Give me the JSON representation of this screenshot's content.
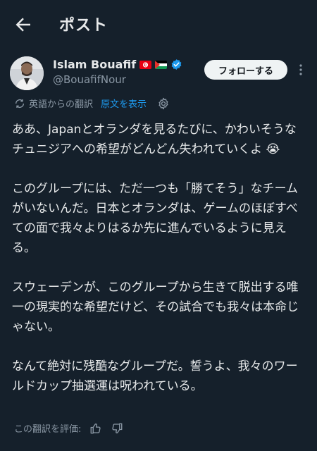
{
  "header": {
    "title": "ポスト",
    "back_icon": "arrow-left-icon"
  },
  "author": {
    "display_name": "Islam Bouafif",
    "handle": "@BouafifNour",
    "badges": [
      "tunisia-flag-icon",
      "palestine-flag-icon",
      "verified-badge-icon"
    ],
    "verified_color": "#1d9bf0"
  },
  "actions": {
    "follow_label": "フォローする",
    "more_icon": "more-vertical-icon"
  },
  "translation": {
    "label": "英語からの翻訳",
    "show_original": "原文を表示",
    "settings_icon": "gear-icon"
  },
  "tweet": {
    "paragraphs": [
      "ああ、Japanとオランダを見るたびに、かわいそうなチュニジアへの希望がどんどん失われていくよ 😭",
      "このグループには、ただ一つも「勝てそう」なチームがいないんだ。日本とオランダは、ゲームのほぼすべての面で我々よりはるか先に進んでいるように見える。",
      "スウェーデンが、このグループから生きて脱出する唯一の現実的な希望だけど、その試合でも我々は本命じゃない。",
      "なんて絶対に残酷なグループだ。誓うよ、我々のワールドカップ抽選運は呪われている。"
    ]
  },
  "rating": {
    "label": "この翻訳を評価:",
    "icons": [
      "thumbs-up-icon",
      "thumbs-down-icon"
    ]
  },
  "colors": {
    "background": "#15202b",
    "text": "#e7e9ea",
    "muted": "#8b98a5",
    "accent": "#1d9bf0"
  }
}
